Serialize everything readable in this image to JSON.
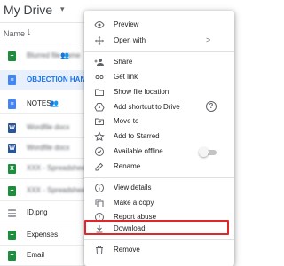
{
  "drive": {
    "title": "My Drive",
    "caret": "▾",
    "column_name": "Name",
    "sort_arrow": "↓"
  },
  "files": [
    {
      "name": "file-sheet-1",
      "icon": "sheets-icon",
      "display": "Blurred file name",
      "shared": true
    },
    {
      "name": "OBJECTION HANDLER",
      "icon": "docs-icon",
      "selected": true
    },
    {
      "name": "NOTES",
      "icon": "docs-icon",
      "shared": true
    },
    {
      "name": "Wordfile docx",
      "icon": "word-icon"
    },
    {
      "name": "Wordfile docx",
      "icon": "word-icon"
    },
    {
      "name": "XXX - Spreadsheet",
      "icon": "excel-icon"
    },
    {
      "name": "XXX - Spreadsheet file",
      "icon": "sheets-icon"
    },
    {
      "name": "ID.png",
      "icon": "image-icon"
    },
    {
      "name": "Expenses",
      "icon": "sheets-icon"
    },
    {
      "name": "Email",
      "icon": "sheets-icon"
    }
  ],
  "menu": {
    "preview": "Preview",
    "open_with": "Open with",
    "share": "Share",
    "get_link": "Get link",
    "show_file_location": "Show file location",
    "add_shortcut": "Add shortcut to Drive",
    "move_to": "Move to",
    "add_starred": "Add to Starred",
    "available_offline": "Available offline",
    "rename": "Rename",
    "view_details": "View details",
    "make_copy": "Make a copy",
    "report_abuse": "Report abuse",
    "download": "Download",
    "remove": "Remove",
    "open_with_chevron": ">",
    "help_glyph": "?"
  },
  "colors": {
    "highlight": "#e0252b",
    "selected_text": "#1a73e8",
    "selected_row": "#e8f0fe"
  }
}
